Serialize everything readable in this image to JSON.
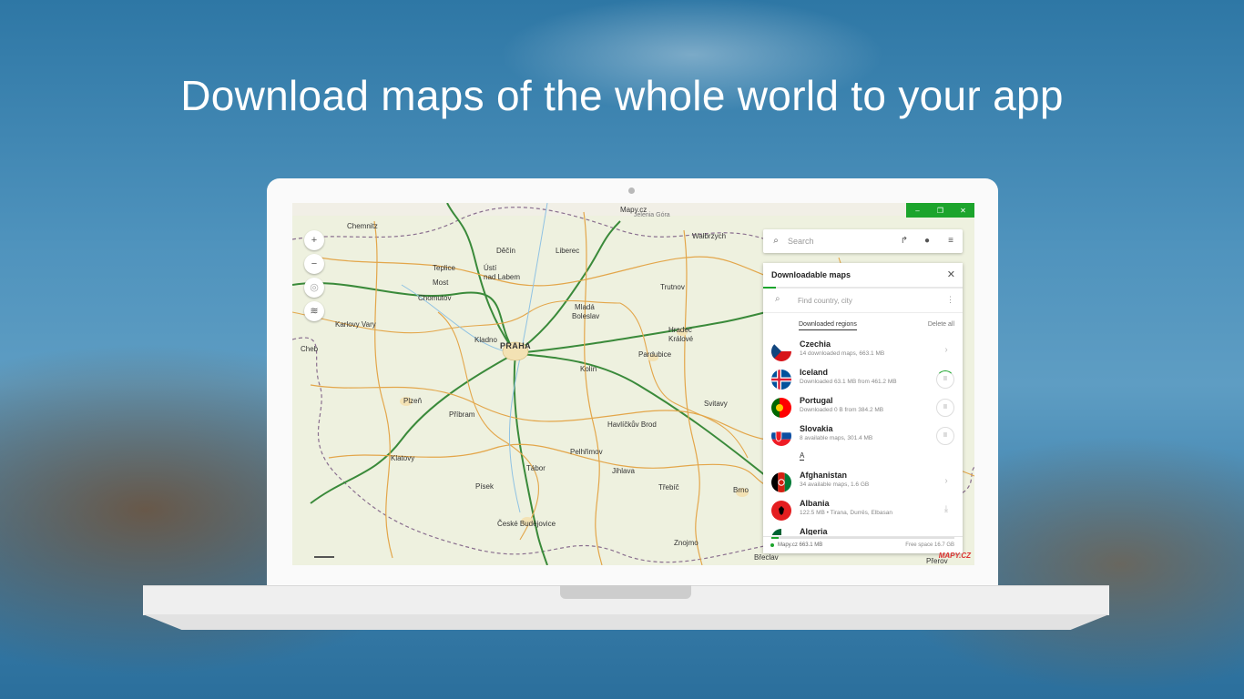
{
  "headline": "Download maps of the whole world to your app",
  "window": {
    "title": "Mapy.cz",
    "minimize": "–",
    "restore": "❐",
    "close": "✕",
    "accent": "#1ca42c"
  },
  "map_controls": {
    "zoom_in": "+",
    "zoom_out": "−",
    "locate_icon": "◎",
    "layers_icon": "≋"
  },
  "map_labels": {
    "chemnitz": "Chemnitz",
    "jelenia_gora": "Jelenia Góra",
    "walbrzych": "Wałbrzych",
    "decin": "Děčín",
    "liberec": "Liberec",
    "teplice": "Teplice",
    "usti": "Ústí",
    "nad_labem": "nad Labem",
    "most": "Most",
    "trutnov": "Trutnov",
    "chomutov": "Chomutov",
    "mlada": "Mladá",
    "boleslav": "Boleslav",
    "hradec": "Hradec",
    "kralove": "Králové",
    "karlovy_vary": "Karlovy Vary",
    "kladno": "Kladno",
    "praha": "PRAHA",
    "pardubice": "Pardubice",
    "cheb": "Cheb",
    "kolin": "Kolín",
    "plzen": "Plzeň",
    "svitavy": "Svitavy",
    "pribram": "Příbram",
    "havlickuv_brod": "Havlíčkův Brod",
    "klatovy": "Klatovy",
    "pelhrimov": "Pelhřimov",
    "tabor": "Tábor",
    "jihlava": "Jihlava",
    "trebic": "Třebíč",
    "pisek": "Písek",
    "brno": "Brno",
    "ceske_budejovice": "České Budějovice",
    "znojmo": "Znojmo",
    "breclav": "Břeclav",
    "prerov": "Přerov"
  },
  "search": {
    "placeholder": "Search",
    "route_icon": "↱",
    "profile_icon": "●",
    "menu_icon": "≡"
  },
  "panel": {
    "title": "Downloadable maps",
    "close": "✕",
    "find_placeholder": "Find country, city",
    "find_icon": "⌕",
    "more_icon": "⋮",
    "tab_downloaded": "Downloaded regions",
    "delete_all": "Delete all",
    "downloaded": [
      {
        "name": "Czechia",
        "info": "14 downloaded maps, 663.1 MB",
        "action": "›"
      },
      {
        "name": "Iceland",
        "info": "Downloaded 63.1 MB from 461.2 MB",
        "action": "II"
      },
      {
        "name": "Portugal",
        "info": "Downloaded 0 B from 384.2 MB",
        "action": "II"
      },
      {
        "name": "Slovakia",
        "info": "8 available maps, 301.4 MB",
        "action": "II"
      }
    ],
    "letter": "A",
    "available": [
      {
        "name": "Afghanistan",
        "info": "34 available maps, 1.6 GB",
        "action": "›"
      },
      {
        "name": "Albania",
        "info": "122.5 MB • Tirana, Durrës, Elbasan",
        "action": "⤓"
      },
      {
        "name": "Algeria",
        "info": "",
        "action": "›"
      }
    ],
    "footer_left": "Mapy.cz 663.1 MB",
    "footer_right": "Free space 16.7 GB",
    "storage_used_fraction": 0.04
  },
  "brand": "MAPY.CZ"
}
